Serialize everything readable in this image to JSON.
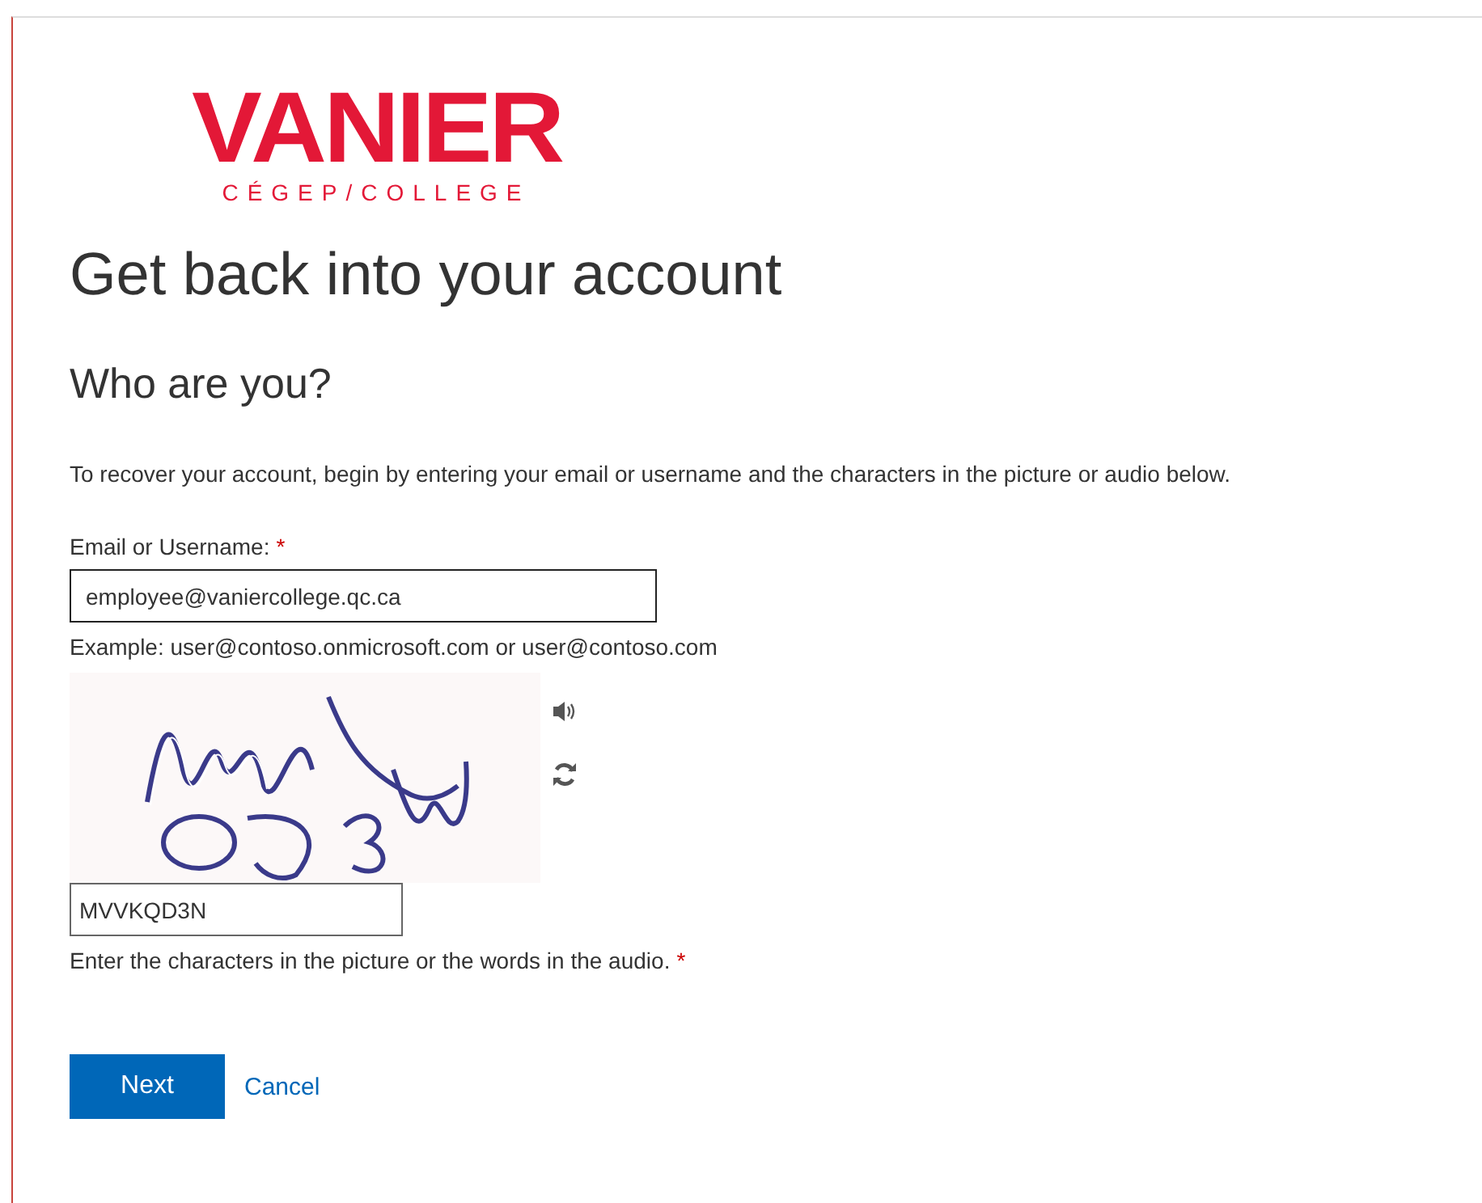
{
  "logo": {
    "name": "VANIER",
    "subtitle": "CÉGEP/COLLEGE"
  },
  "title": "Get back into your account",
  "subtitle": "Who are you?",
  "intro": "To recover your account, begin by entering your email or username and the characters in the picture or audio below.",
  "email_field": {
    "label": "Email or Username:",
    "required_mark": "*",
    "value": "employee@vaniercollege.qc.ca",
    "hint": "Example: user@contoso.onmicrosoft.com or user@contoso.com"
  },
  "captcha": {
    "kind": "picture",
    "answer": "MVVKQD3N",
    "hint": "Enter the characters in the picture or the words in the audio.",
    "required_mark": "*"
  },
  "buttons": [
    {
      "kind": "primary",
      "label": "Next"
    },
    {
      "kind": "link",
      "label": "Cancel"
    }
  ]
}
